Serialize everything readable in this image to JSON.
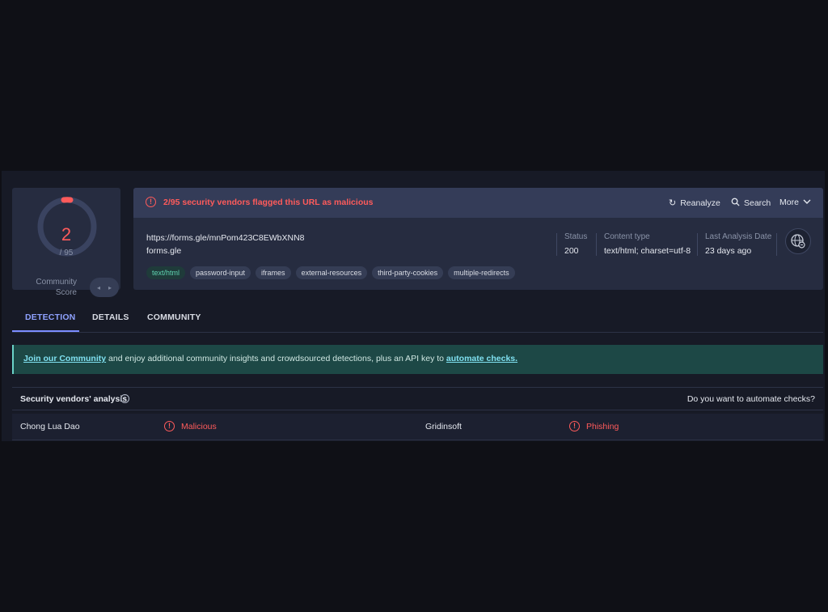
{
  "score": {
    "value": "2",
    "total": "/ 95",
    "community_label_1": "Community",
    "community_label_2": "Score",
    "vote_icon_left": "thumb-down-icon",
    "vote_icon_right": "thumb-up-icon"
  },
  "alert": {
    "text": "2/95 security vendors flagged this URL as malicious",
    "color": "#ff5b5b"
  },
  "actions": {
    "reanalyze": "Reanalyze",
    "search": "Search",
    "more": "More"
  },
  "target": {
    "url": "https://forms.gle/mnPom423C8EWbXNN8",
    "domain": "forms.gle"
  },
  "tags": [
    "text/html",
    "password-input",
    "iframes",
    "external-resources",
    "third-party-cookies",
    "multiple-redirects"
  ],
  "meta": {
    "status_label": "Status",
    "status_value": "200",
    "content_type_label": "Content type",
    "content_type_value": "text/html; charset=utf-8",
    "last_analysis_label": "Last Analysis Date",
    "last_analysis_value": "23 days ago"
  },
  "tabs": [
    {
      "label": "DETECTION",
      "active": true
    },
    {
      "label": "DETAILS",
      "active": false
    },
    {
      "label": "COMMUNITY",
      "active": false
    }
  ],
  "banner": {
    "link1": "Join our Community",
    "middle": " and enjoy additional community insights and crowdsourced detections, plus an API key to ",
    "link2": "automate checks."
  },
  "vendors": {
    "title": "Security vendors' analysis",
    "automate_question": "Do you want to automate checks?",
    "rows": [
      {
        "vendor_a": "Chong Lua Dao",
        "verdict_a": "Malicious",
        "vendor_b": "Gridinsoft",
        "verdict_b": "Phishing"
      }
    ]
  },
  "colors": {
    "accent": "#7c8cff",
    "danger": "#ff5b5b",
    "banner": "#1d4846"
  }
}
